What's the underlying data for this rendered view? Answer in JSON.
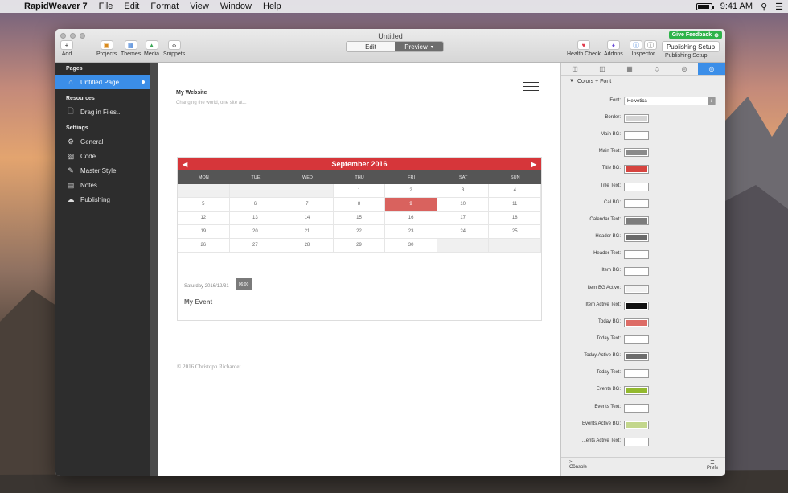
{
  "menubar": {
    "app_name": "RapidWeaver 7",
    "menus": [
      "File",
      "Edit",
      "Format",
      "View",
      "Window",
      "Help"
    ],
    "time": "9:41 AM"
  },
  "window": {
    "title": "Untitled",
    "feedback_label": "Give Feedback",
    "toolbar": {
      "add": "Add",
      "projects": "Projects",
      "themes": "Themes",
      "media": "Media",
      "snippets": "Snippets",
      "edit": "Edit",
      "preview": "Preview",
      "health_check": "Health Check",
      "addons": "Addons",
      "inspector": "Inspector",
      "publishing_button": "Publishing Setup",
      "publishing_label": "Publishing Setup"
    }
  },
  "sidebar": {
    "pages_heading": "Pages",
    "pages": [
      {
        "label": "Untitled Page",
        "icon": "house-icon"
      }
    ],
    "resources_heading": "Resources",
    "resources": [
      {
        "label": "Drag in Files...",
        "icon": "file-icon"
      }
    ],
    "settings_heading": "Settings",
    "settings": [
      {
        "label": "General",
        "icon": "gear-icon"
      },
      {
        "label": "Code",
        "icon": "code-icon"
      },
      {
        "label": "Master Style",
        "icon": "brush-icon"
      },
      {
        "label": "Notes",
        "icon": "notes-icon"
      },
      {
        "label": "Publishing",
        "icon": "cloud-icon"
      }
    ]
  },
  "preview": {
    "site_title": "My Website",
    "site_subtitle": "Changing the world, one site at...",
    "calendar": {
      "month_title": "September 2016",
      "weekdays": [
        "MON",
        "TUE",
        "WED",
        "THU",
        "FRI",
        "SAT",
        "SUN"
      ],
      "weeks": [
        [
          "",
          "",
          "",
          "1",
          "2",
          "3",
          "4"
        ],
        [
          "5",
          "6",
          "7",
          "8",
          "9",
          "10",
          "11"
        ],
        [
          "12",
          "13",
          "14",
          "15",
          "16",
          "17",
          "18"
        ],
        [
          "19",
          "20",
          "21",
          "22",
          "23",
          "24",
          "25"
        ],
        [
          "26",
          "27",
          "28",
          "29",
          "30",
          "",
          ""
        ]
      ],
      "today": "9"
    },
    "event": {
      "date": "Saturday 2016/12/31",
      "time": "06:00",
      "title": "My Event"
    },
    "copyright": "© 2016 Christoph Richardet"
  },
  "inspector": {
    "section_title": "Colors + Font",
    "font_label": "Font:",
    "font_value": "Helvetica",
    "colors": [
      {
        "label": "Border:",
        "color": "#d4d4d4"
      },
      {
        "label": "Main BG:",
        "color": "#ffffff"
      },
      {
        "label": "Main Text:",
        "color": "#8a8a8a"
      },
      {
        "label": "Title BG:",
        "color": "#d6443f"
      },
      {
        "label": "Title Text:",
        "color": "#ffffff"
      },
      {
        "label": "Cal BG:",
        "color": "#ffffff"
      },
      {
        "label": "Calendar Text:",
        "color": "#7d7d7d"
      },
      {
        "label": "Header BG:",
        "color": "#6a6a6a"
      },
      {
        "label": "Header Text:",
        "color": "#ffffff"
      },
      {
        "label": "Item BG:",
        "color": "#ffffff"
      },
      {
        "label": "Item BG Active:",
        "color": "#f2f2f2"
      },
      {
        "label": "Item Active Text:",
        "color": "#111111"
      },
      {
        "label": "Today BG:",
        "color": "#dd6c66"
      },
      {
        "label": "Today Text:",
        "color": "#ffffff"
      },
      {
        "label": "Today Active BG:",
        "color": "#6c6c6c"
      },
      {
        "label": "Today Text:",
        "color": "#ffffff"
      },
      {
        "label": "Events BG:",
        "color": "#93b92e"
      },
      {
        "label": "Events Text:",
        "color": "#ffffff"
      },
      {
        "label": "Events Active BG:",
        "color": "#c3d78c"
      },
      {
        "label": "...ents Active Text:",
        "color": "#ffffff"
      }
    ],
    "console_label": "Console",
    "prefs_label": "Prefs"
  }
}
